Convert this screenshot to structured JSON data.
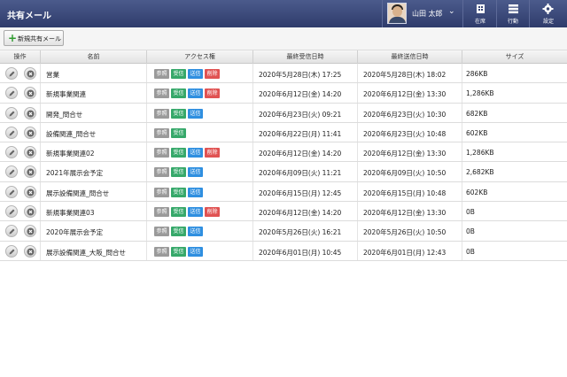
{
  "header": {
    "title": "共有メール",
    "user_name": "山田 太郎",
    "tools": [
      {
        "label": "在席",
        "icon": "building-icon"
      },
      {
        "label": "行動",
        "icon": "schedule-icon"
      },
      {
        "label": "設定",
        "icon": "gear-icon"
      }
    ]
  },
  "toolbar": {
    "new_label": "新規共有メール"
  },
  "table": {
    "columns": [
      "操作",
      "名前",
      "アクセス権",
      "最終受信日時",
      "最終送信日時",
      "サイズ"
    ],
    "badge_labels": {
      "view": "参照",
      "recv": "受信",
      "send": "送信",
      "del": "削除"
    },
    "rows": [
      {
        "name": "営業",
        "access": [
          "view",
          "recv",
          "send",
          "del"
        ],
        "last_received": "2020年5月28日(木) 17:25",
        "last_sent": "2020年5月28日(木) 18:02",
        "size": "286KB"
      },
      {
        "name": "新規事業関連",
        "access": [
          "view",
          "recv",
          "send",
          "del"
        ],
        "last_received": "2020年6月12日(金) 14:20",
        "last_sent": "2020年6月12日(金) 13:30",
        "size": "1,286KB"
      },
      {
        "name": "開発_問合せ",
        "access": [
          "view",
          "recv",
          "send"
        ],
        "last_received": "2020年6月23日(火) 09:21",
        "last_sent": "2020年6月23日(火) 10:30",
        "size": "682KB"
      },
      {
        "name": "設備関連_問合せ",
        "access": [
          "view",
          "recv"
        ],
        "last_received": "2020年6月22日(月) 11:41",
        "last_sent": "2020年6月23日(火) 10:48",
        "size": "602KB"
      },
      {
        "name": "新規事業関連02",
        "access": [
          "view",
          "recv",
          "send",
          "del"
        ],
        "last_received": "2020年6月12日(金) 14:20",
        "last_sent": "2020年6月12日(金) 13:30",
        "size": "1,286KB"
      },
      {
        "name": "2021年展示会予定",
        "access": [
          "view",
          "recv",
          "send"
        ],
        "last_received": "2020年6月09日(火) 11:21",
        "last_sent": "2020年6月09日(火) 10:50",
        "size": "2,682KB"
      },
      {
        "name": "展示設備関連_問合せ",
        "access": [
          "view",
          "recv",
          "send"
        ],
        "last_received": "2020年6月15日(月) 12:45",
        "last_sent": "2020年6月15日(月) 10:48",
        "size": "602KB"
      },
      {
        "name": "新規事業関連03",
        "access": [
          "view",
          "recv",
          "send",
          "del"
        ],
        "last_received": "2020年6月12日(金) 14:20",
        "last_sent": "2020年6月12日(金) 13:30",
        "size": "0B"
      },
      {
        "name": "2020年展示会予定",
        "access": [
          "view",
          "recv",
          "send"
        ],
        "last_received": "2020年5月26日(火) 16:21",
        "last_sent": "2020年5月26日(火) 10:50",
        "size": "0B"
      },
      {
        "name": "展示設備関連_大阪_問合せ",
        "access": [
          "view",
          "recv",
          "send"
        ],
        "last_received": "2020年6月01日(月) 10:45",
        "last_sent": "2020年6月01日(月) 12:43",
        "size": "0B"
      }
    ]
  }
}
